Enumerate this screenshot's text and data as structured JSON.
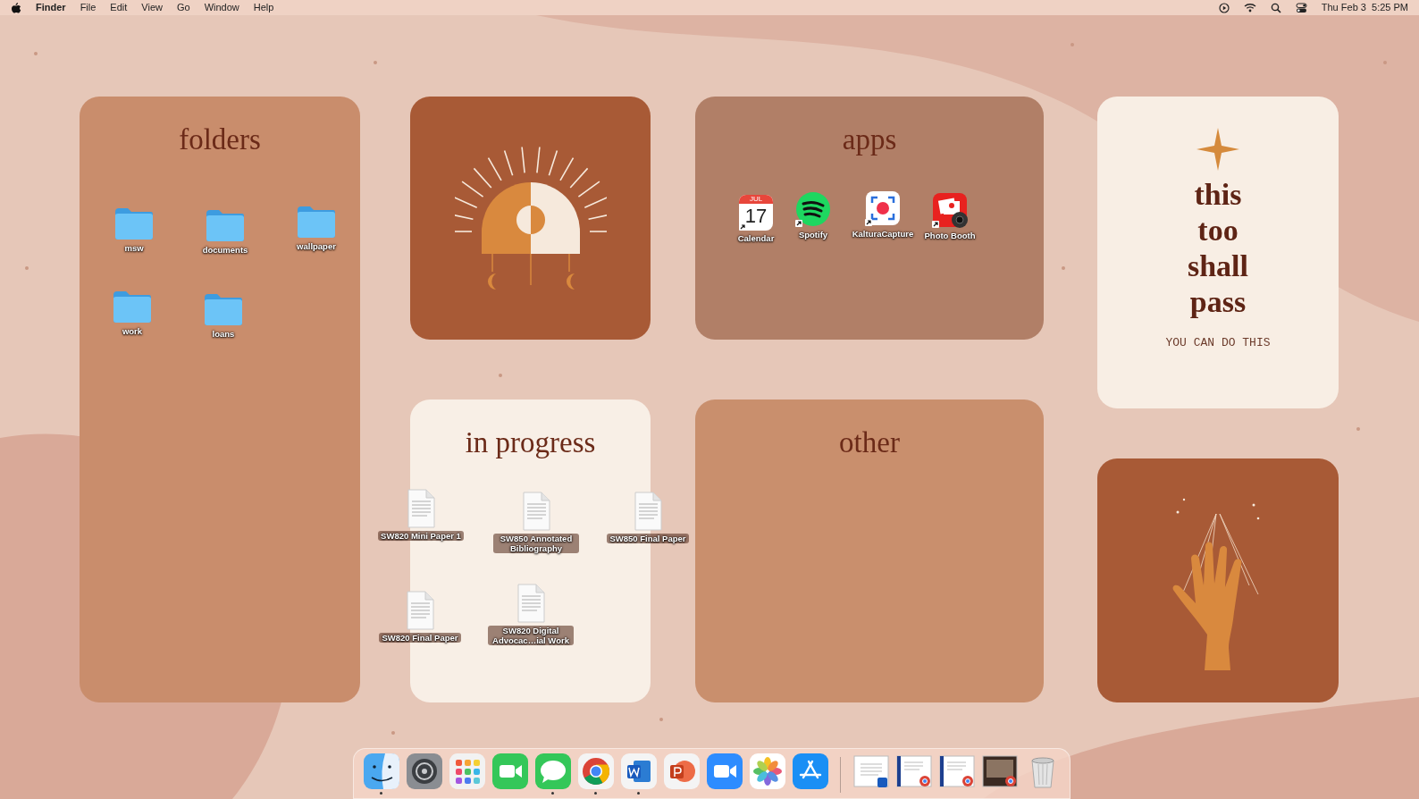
{
  "menu_bar": {
    "app_name": "Finder",
    "menus": [
      "File",
      "Edit",
      "View",
      "Go",
      "Window",
      "Help"
    ],
    "clock": "Thu Feb 3  5:25 PM"
  },
  "wallpaper": {
    "folders_title": "folders",
    "apps_title": "apps",
    "in_progress_title": "in progress",
    "other_title": "other",
    "quote_lines": [
      "this",
      "too",
      "shall",
      "pass"
    ],
    "quote_caption": "YOU CAN DO THIS"
  },
  "desktop_icons": [
    {
      "kind": "folder",
      "label": "msw"
    },
    {
      "kind": "folder",
      "label": "documents"
    },
    {
      "kind": "folder",
      "label": "wallpaper"
    },
    {
      "kind": "folder",
      "label": "work"
    },
    {
      "kind": "folder",
      "label": "loans"
    },
    {
      "kind": "calendar",
      "label": "Calendar",
      "alias": true,
      "month": "JUL",
      "day": "17"
    },
    {
      "kind": "spotify",
      "label": "Spotify",
      "alias": true
    },
    {
      "kind": "capture",
      "label": "KalturaCapture",
      "alias": true
    },
    {
      "kind": "photobooth",
      "label": "Photo Booth",
      "alias": true
    },
    {
      "kind": "document",
      "label": "SW820 Mini Paper 1"
    },
    {
      "kind": "document",
      "label": "SW850 Annotated Bibliography"
    },
    {
      "kind": "document",
      "label": "SW850 Final Paper"
    },
    {
      "kind": "document",
      "label": "SW820 Final Paper"
    },
    {
      "kind": "document",
      "label": "SW820 Digital Advocac…ial Work"
    }
  ],
  "dock": [
    {
      "kind": "finder",
      "running": true
    },
    {
      "kind": "settings",
      "running": false
    },
    {
      "kind": "launchpad",
      "running": false
    },
    {
      "kind": "facetime",
      "running": false
    },
    {
      "kind": "messages",
      "running": true
    },
    {
      "kind": "chrome",
      "running": true
    },
    {
      "kind": "word",
      "running": true
    },
    {
      "kind": "powerpoint",
      "running": false
    },
    {
      "kind": "zoom",
      "running": false
    },
    {
      "kind": "photos",
      "running": false
    },
    {
      "kind": "appstore",
      "running": false
    },
    {
      "kind": "separator"
    },
    {
      "kind": "window-word"
    },
    {
      "kind": "window-chrome"
    },
    {
      "kind": "window-chrome"
    },
    {
      "kind": "window-photo"
    },
    {
      "kind": "trash"
    }
  ]
}
